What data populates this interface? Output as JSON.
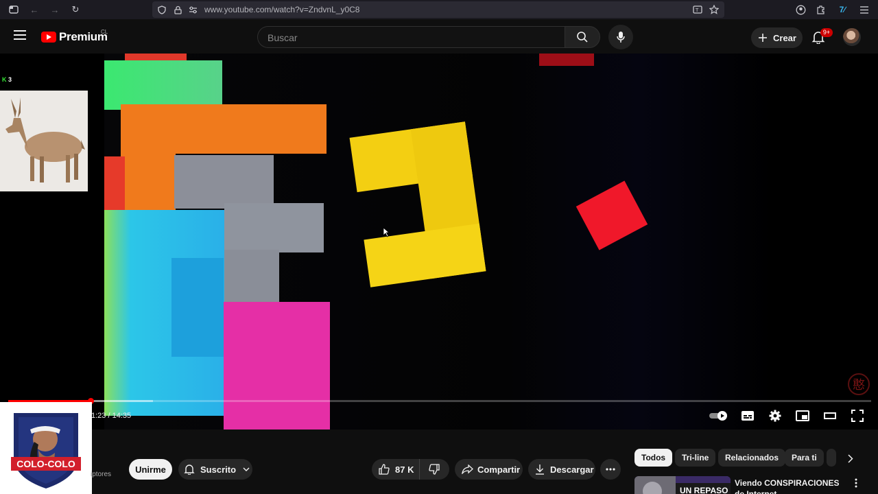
{
  "browser": {
    "url": "www.youtube.com/watch?v=ZndvnL_y0C8"
  },
  "header": {
    "logo_text": "Premium",
    "country_code": "CL",
    "search_placeholder": "Buscar",
    "create_label": "Crear",
    "notifications_badge": "9+"
  },
  "player": {
    "overlay_counter": "3",
    "time": "1:23 / 14:35",
    "progress_fraction": 0.0951,
    "buffered_fraction": 0.168,
    "autoplay_on": true
  },
  "club_card": {
    "text": "COLO-COLO"
  },
  "actions": {
    "fragment_text": "iptores",
    "join_label": "Unirme",
    "subscribed_label": "Suscrito",
    "like_count": "87 K",
    "share_label": "Compartir",
    "download_label": "Descargar"
  },
  "filters": [
    "Todos",
    "Tri-line",
    "Relacionados",
    "Para ti"
  ],
  "recommended": {
    "title": "Viendo CONSPIRACIONES de Internet",
    "thumb_text": "UN REPASO"
  }
}
